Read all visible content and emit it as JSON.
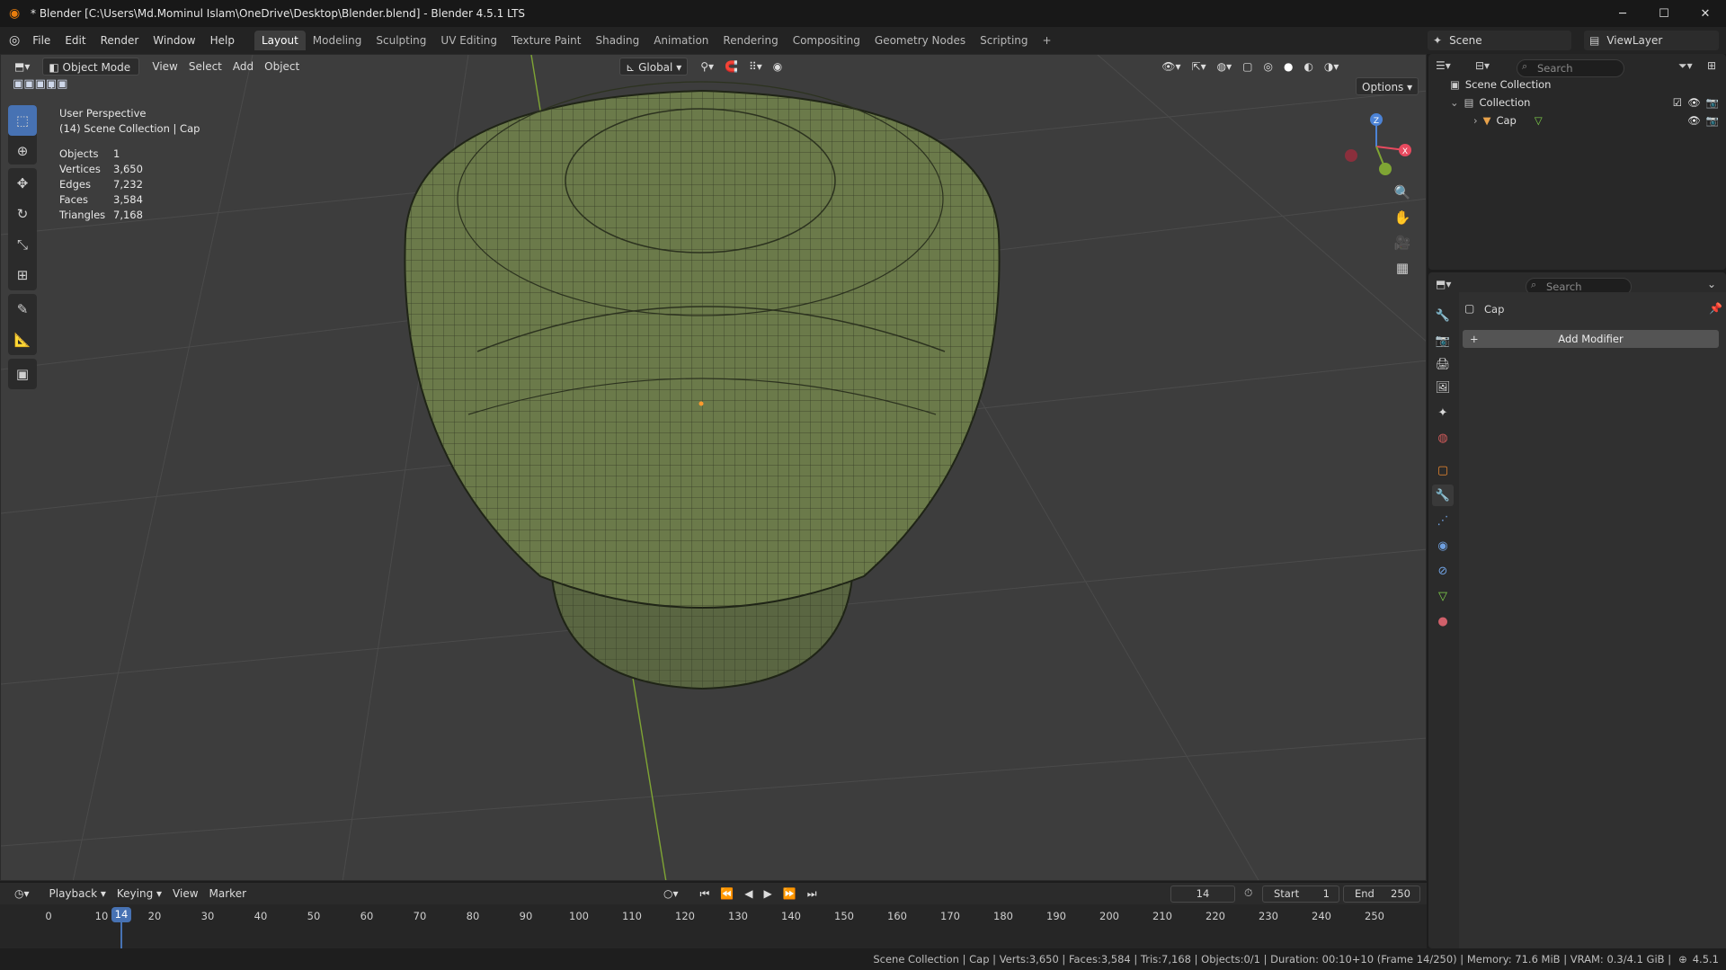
{
  "window": {
    "title": "* Blender [C:\\Users\\Md.Mominul Islam\\OneDrive\\Desktop\\Blender.blend] - Blender 4.5.1 LTS",
    "minimize": "─",
    "maximize": "☐",
    "close": "✕"
  },
  "menu": [
    "File",
    "Edit",
    "Render",
    "Window",
    "Help"
  ],
  "workspaces": [
    "Layout",
    "Modeling",
    "Sculpting",
    "UV Editing",
    "Texture Paint",
    "Shading",
    "Animation",
    "Rendering",
    "Compositing",
    "Geometry Nodes",
    "Scripting"
  ],
  "workspace_add": "+",
  "scene": {
    "label": "Scene",
    "viewlayer": "ViewLayer"
  },
  "viewport_header": {
    "mode": "Object Mode",
    "menus": [
      "View",
      "Select",
      "Add",
      "Object"
    ],
    "orientation": "Global",
    "options": "Options"
  },
  "overlay": {
    "perspective": "User Perspective",
    "context": "(14) Scene Collection | Cap",
    "stats": [
      {
        "label": "Objects",
        "value": "1"
      },
      {
        "label": "Vertices",
        "value": "3,650"
      },
      {
        "label": "Edges",
        "value": "7,232"
      },
      {
        "label": "Faces",
        "value": "3,584"
      },
      {
        "label": "Triangles",
        "value": "7,168"
      }
    ]
  },
  "gizmo": {
    "z": "Z",
    "x": "X"
  },
  "outliner": {
    "search_placeholder": "Search",
    "scene_collection": "Scene Collection",
    "collection": "Collection",
    "object": "Cap"
  },
  "properties": {
    "search_placeholder": "Search",
    "object_name": "Cap",
    "add_modifier": "Add Modifier"
  },
  "timeline": {
    "menus": [
      "Playback",
      "Keying",
      "View",
      "Marker"
    ],
    "current_frame": "14",
    "start_label": "Start",
    "start": "1",
    "end_label": "End",
    "end": "250",
    "ticks": [
      "0",
      "10",
      "20",
      "30",
      "40",
      "50",
      "60",
      "70",
      "80",
      "90",
      "100",
      "110",
      "120",
      "130",
      "140",
      "150",
      "160",
      "170",
      "180",
      "190",
      "200",
      "210",
      "220",
      "230",
      "240",
      "250"
    ],
    "playhead": "14"
  },
  "statusbar": {
    "text": "Scene Collection | Cap | Verts:3,650 | Faces:3,584 | Tris:7,168 | Objects:0/1 | Duration: 00:10+10 (Frame 14/250) | Memory: 71.6 MiB | VRAM: 0.3/4.1 GiB |",
    "version": "4.5.1"
  },
  "colors": {
    "accent": "#4772b3",
    "mesh": "#6b7a4a",
    "axis_green": "#7fa534",
    "axis_red": "#e84a5f"
  }
}
